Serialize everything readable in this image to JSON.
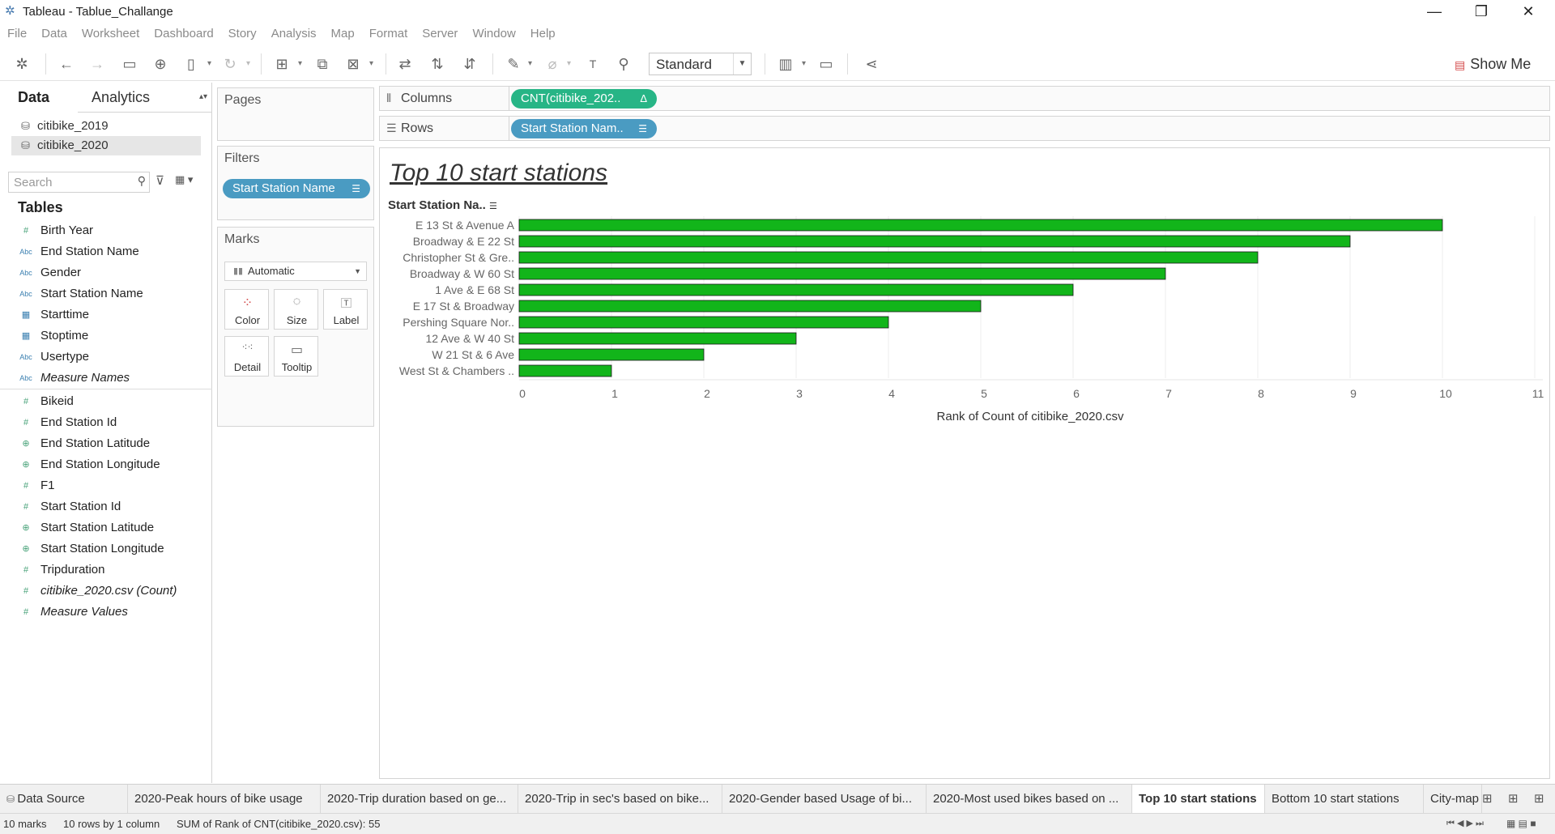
{
  "window": {
    "title": "Tableau - Tablue_Challange",
    "minimize": "—",
    "restore": "❐",
    "close": "✕"
  },
  "menu": [
    "File",
    "Data",
    "Worksheet",
    "Dashboard",
    "Story",
    "Analysis",
    "Map",
    "Format",
    "Server",
    "Window",
    "Help"
  ],
  "toolbar": {
    "fit": "Standard",
    "show_me": "Show Me"
  },
  "data_pane": {
    "tab_data": "Data",
    "tab_analytics": "Analytics",
    "datasources": [
      "citibike_2019",
      "citibike_2020"
    ],
    "search_placeholder": "Search",
    "tables_title": "Tables",
    "dimensions": [
      {
        "name": "Birth Year",
        "type": "#"
      },
      {
        "name": "End Station Name",
        "type": "Abc"
      },
      {
        "name": "Gender",
        "type": "Abc"
      },
      {
        "name": "Start Station Name",
        "type": "Abc"
      },
      {
        "name": "Starttime",
        "type": "cal"
      },
      {
        "name": "Stoptime",
        "type": "cal"
      },
      {
        "name": "Usertype",
        "type": "Abc"
      },
      {
        "name": "Measure Names",
        "type": "Abc"
      }
    ],
    "measures": [
      {
        "name": "Bikeid",
        "type": "#"
      },
      {
        "name": "End Station Id",
        "type": "#"
      },
      {
        "name": "End Station Latitude",
        "type": "geo"
      },
      {
        "name": "End Station Longitude",
        "type": "geo"
      },
      {
        "name": "F1",
        "type": "#"
      },
      {
        "name": "Start Station Id",
        "type": "#"
      },
      {
        "name": "Start Station Latitude",
        "type": "geo"
      },
      {
        "name": "Start Station Longitude",
        "type": "geo"
      },
      {
        "name": "Tripduration",
        "type": "#"
      },
      {
        "name": "citibike_2020.csv (Count)",
        "type": "#"
      },
      {
        "name": "Measure Values",
        "type": "#"
      }
    ]
  },
  "cards": {
    "pages": "Pages",
    "filters": "Filters",
    "filter_pill": "Start Station Name",
    "marks": "Marks",
    "marks_type": "Automatic",
    "mark_buttons": [
      "Color",
      "Size",
      "Label",
      "Detail",
      "Tooltip"
    ]
  },
  "shelves": {
    "columns_label": "Columns",
    "columns_pill": "CNT(citibike_202..",
    "rows_label": "Rows",
    "rows_pill": "Start Station Nam.."
  },
  "viz": {
    "title": "Top 10 start stations",
    "row_header": "Start Station Na.."
  },
  "chart_data": {
    "type": "bar",
    "orientation": "horizontal",
    "categories": [
      "E 13 St & Avenue A",
      "Broadway & E 22 St",
      "Christopher St & Gre..",
      "Broadway & W 60 St",
      "1 Ave & E 68 St",
      "E 17 St & Broadway",
      "Pershing Square Nor..",
      "12 Ave & W 40 St",
      "W 21 St & 6 Ave",
      "West St & Chambers .."
    ],
    "values": [
      10,
      9,
      8,
      7,
      6,
      5,
      4,
      3,
      2,
      1
    ],
    "xlabel": "Rank of Count of citibike_2020.csv",
    "xlim": [
      0,
      11
    ],
    "xticks": [
      0,
      1,
      2,
      3,
      4,
      5,
      6,
      7,
      8,
      9,
      10,
      11
    ],
    "bar_color": "#12b51a",
    "grid": true
  },
  "sheet_tabs": [
    "Data Source",
    "2020-Peak hours of bike usage",
    "2020-Trip duration based on ge...",
    "2020-Trip in sec's based on bike...",
    "2020-Gender based Usage of bi...",
    "2020-Most used bikes based on ...",
    "Top 10 start stations",
    "Bottom 10 start stations",
    "City-map"
  ],
  "active_tab": "Top 10 start stations",
  "status": {
    "marks": "10 marks",
    "rows_cols": "10 rows by 1 column",
    "sum": "SUM of Rank of CNT(citibike_2020.csv): 55"
  }
}
